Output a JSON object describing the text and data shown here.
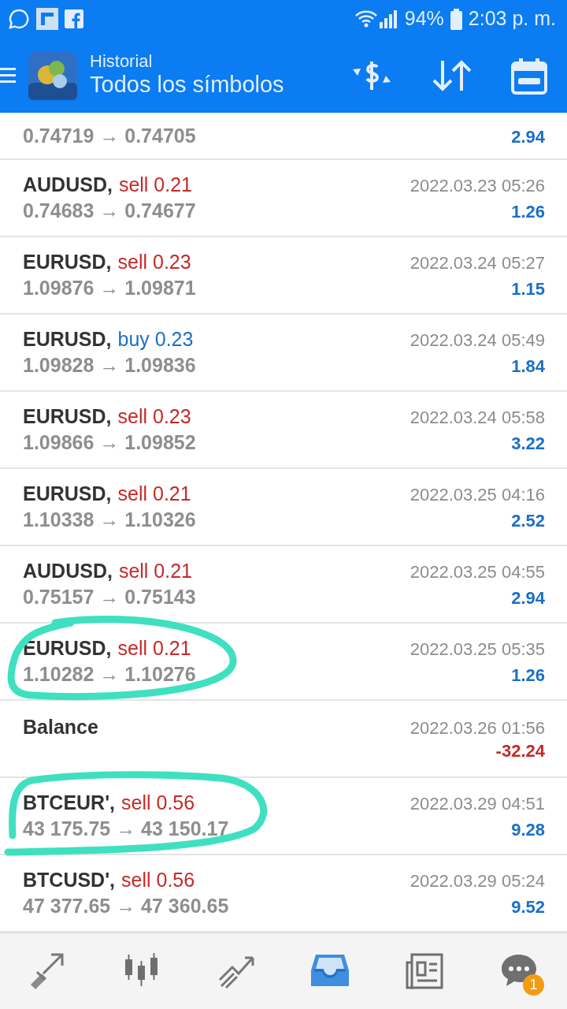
{
  "status_bar": {
    "battery": "94%",
    "time": "2:03 p. m."
  },
  "header": {
    "title": "Historial",
    "subtitle": "Todos los símbolos"
  },
  "deals": [
    {
      "kind": "partial",
      "prices": "0.74719 → 0.74705",
      "profit": "2.94",
      "color": "#1a6fc9"
    },
    {
      "kind": "trade",
      "symbol": "AUDUSD,",
      "side": "sell",
      "volume": "0.21",
      "time": "2022.03.23 05:26",
      "prices": "0.74683 → 0.74677",
      "profit": "1.26",
      "color": "#1a6fc9"
    },
    {
      "kind": "trade",
      "symbol": "EURUSD,",
      "side": "sell",
      "volume": "0.23",
      "time": "2022.03.24 05:27",
      "prices": "1.09876 → 1.09871",
      "profit": "1.15",
      "color": "#1a6fc9"
    },
    {
      "kind": "trade",
      "symbol": "EURUSD,",
      "side": "buy",
      "volume": "0.23",
      "time": "2022.03.24 05:49",
      "prices": "1.09828 → 1.09836",
      "profit": "1.84",
      "color": "#1a6fc9"
    },
    {
      "kind": "trade",
      "symbol": "EURUSD,",
      "side": "sell",
      "volume": "0.23",
      "time": "2022.03.24 05:58",
      "prices": "1.09866 → 1.09852",
      "profit": "3.22",
      "color": "#1a6fc9"
    },
    {
      "kind": "trade",
      "symbol": "EURUSD,",
      "side": "sell",
      "volume": "0.21",
      "time": "2022.03.25 04:16",
      "prices": "1.10338 → 1.10326",
      "profit": "2.52",
      "color": "#1a6fc9"
    },
    {
      "kind": "trade",
      "symbol": "AUDUSD,",
      "side": "sell",
      "volume": "0.21",
      "time": "2022.03.25 04:55",
      "prices": "0.75157 → 0.75143",
      "profit": "2.94",
      "color": "#1a6fc9"
    },
    {
      "kind": "trade",
      "symbol": "EURUSD,",
      "side": "sell",
      "volume": "0.21",
      "time": "2022.03.25 05:35",
      "prices": "1.10282 → 1.10276",
      "profit": "1.26",
      "color": "#1a6fc9"
    },
    {
      "kind": "balance",
      "symbol": "Balance",
      "time": "2022.03.26 01:56",
      "profit": "-32.24",
      "color": "#c62828"
    },
    {
      "kind": "trade",
      "symbol": "BTCEUR',",
      "side": "sell",
      "volume": "0.56",
      "time": "2022.03.29 04:51",
      "prices": "43 175.75 → 43 150.17",
      "profit": "9.28",
      "color": "#1a6fc9"
    },
    {
      "kind": "trade",
      "symbol": "BTCUSD',",
      "side": "sell",
      "volume": "0.56",
      "time": "2022.03.29 05:24",
      "prices": "47 377.65 → 47 360.65",
      "profit": "9.52",
      "color": "#1a6fc9"
    }
  ],
  "bottom_nav": [
    {
      "kind": "trade",
      "selected": false
    },
    {
      "kind": "quotes",
      "selected": false
    },
    {
      "kind": "chart",
      "selected": false
    },
    {
      "kind": "history",
      "selected": true
    },
    {
      "kind": "news",
      "selected": false
    },
    {
      "kind": "chat",
      "selected": false,
      "badge": "1"
    }
  ]
}
